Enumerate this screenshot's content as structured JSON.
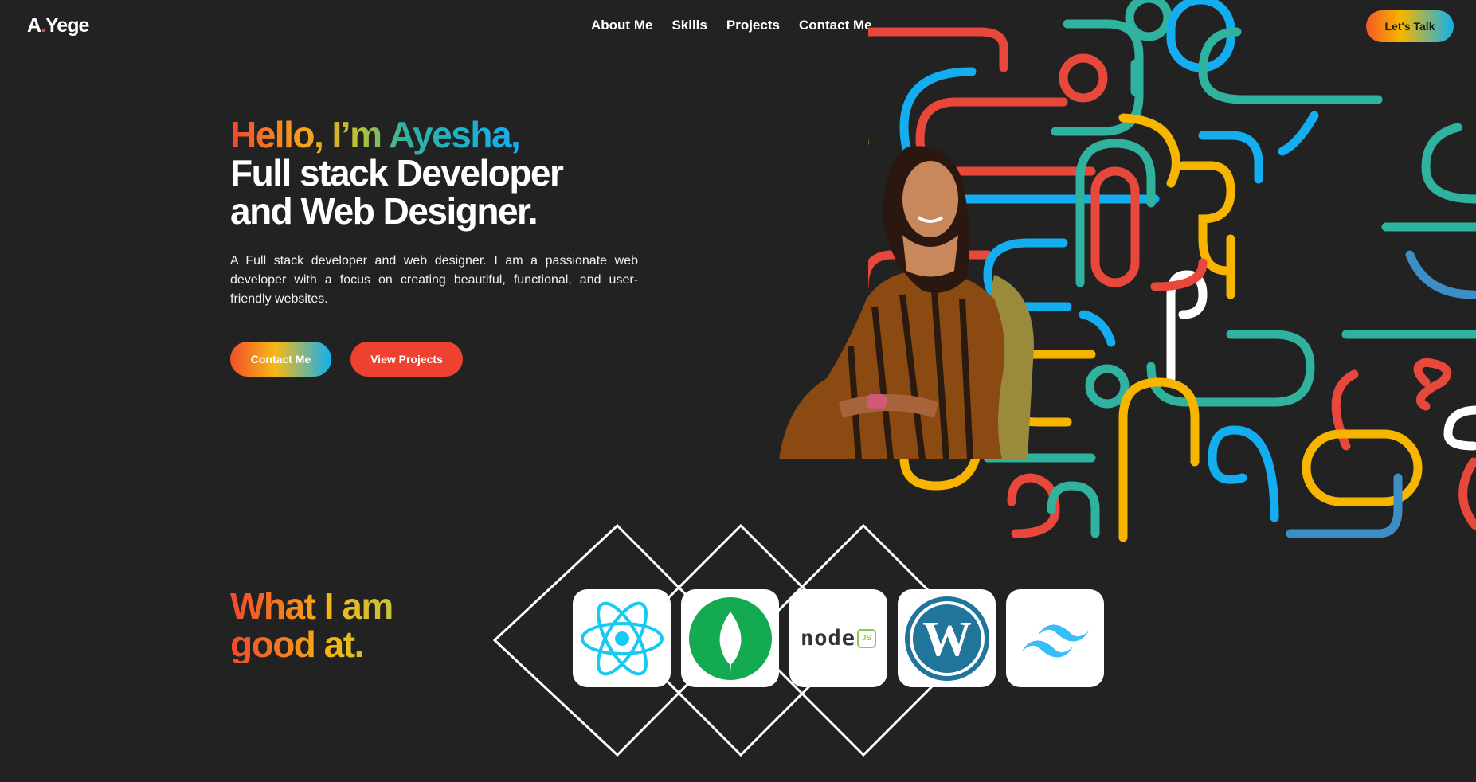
{
  "header": {
    "logo_a": "A",
    "logo_dot": ".",
    "logo_rest": "Yege",
    "nav": [
      "About Me",
      "Skills",
      "Projects",
      "Contact Me"
    ],
    "cta_label": "Let's Talk"
  },
  "hero": {
    "greeting_hello": "Hello,",
    "greeting_im": "I’m",
    "greeting_name": "Ayesha,",
    "title_line2": "Full stack Developer",
    "title_line3": "and Web Designer.",
    "description": "A Full stack developer and web designer. I am a passionate web developer with a focus on creating beautiful, functional, and user-friendly websites.",
    "contact_button": "Contact Me",
    "projects_button": "View Projects"
  },
  "skills": {
    "title_line1": "What I am",
    "title_line2": "good at.",
    "icons": [
      "react-icon",
      "mongodb-icon",
      "nodejs-icon",
      "wordpress-icon",
      "tailwind-icon"
    ],
    "node_text": "node",
    "node_js": "JS",
    "wordpress_letter": "W"
  },
  "colors": {
    "background": "#222222",
    "red": "#ee4231",
    "orange": "#f7a21b",
    "teal": "#2fb39f",
    "blue": "#14aef0"
  }
}
